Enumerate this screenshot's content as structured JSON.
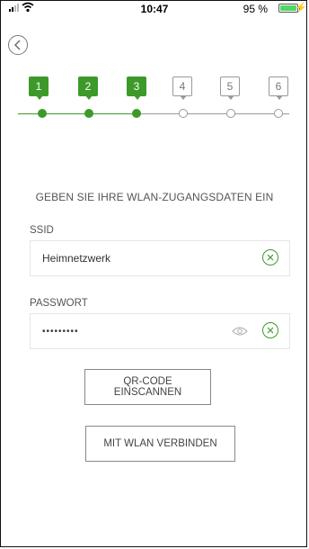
{
  "status_bar": {
    "time": "10:47",
    "battery": "95 %"
  },
  "steps": [
    {
      "num": "1",
      "state": "done"
    },
    {
      "num": "2",
      "state": "done"
    },
    {
      "num": "3",
      "state": "done"
    },
    {
      "num": "4",
      "state": "todo"
    },
    {
      "num": "5",
      "state": "todo"
    },
    {
      "num": "6",
      "state": "todo"
    }
  ],
  "heading": "GEBEN SIE IHRE WLAN-ZUGANGSDATEN EIN",
  "ssid": {
    "label": "SSID",
    "value": "Heimnetzwerk"
  },
  "password": {
    "label": "PASSWORT",
    "value": "•••••••••"
  },
  "buttons": {
    "scan_qr": "QR-CODE EINSCANNEN",
    "connect": "MIT WLAN VERBINDEN"
  },
  "colors": {
    "accent": "#3d9a2a",
    "inactive": "#999999"
  }
}
